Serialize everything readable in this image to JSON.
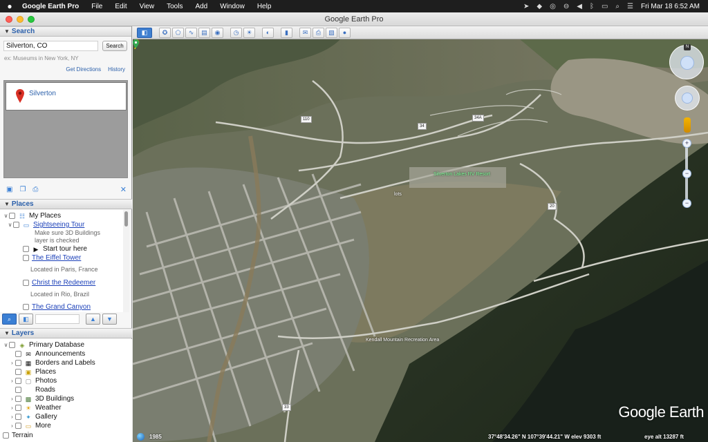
{
  "menubar": {
    "app_name": "Google Earth Pro",
    "menus": [
      "File",
      "Edit",
      "View",
      "Tools",
      "Add",
      "Window",
      "Help"
    ],
    "clock": "Fri Mar 18  6:52 AM"
  },
  "window": {
    "title": "Google Earth Pro"
  },
  "search": {
    "header": "Search",
    "query": "Silverton, CO",
    "button_label": "Search",
    "hint": "ex: Museums in New York, NY",
    "get_directions": "Get Directions",
    "history": "History",
    "result_label": "Silverton"
  },
  "places": {
    "header": "Places",
    "my_places": "My Places",
    "sightseeing_tour": "Sightseeing Tour",
    "tour_note_1": "Make sure 3D Buildings",
    "tour_note_2": "layer is checked",
    "start_tour": "Start tour here",
    "eiffel": "The Eiffel Tower",
    "eiffel_loc": "Located in Paris, France",
    "christ": "Christ the Redeemer",
    "christ_loc": "Located in Rio, Brazil",
    "canyon": "The Grand Canyon"
  },
  "layers": {
    "header": "Layers",
    "items": [
      "Primary Database",
      "Announcements",
      "Borders and Labels",
      "Places",
      "Photos",
      "Roads",
      "3D Buildings",
      "Weather",
      "Gallery",
      "More",
      "Terrain"
    ]
  },
  "map": {
    "labels": {
      "resort": "Silverton Lakes RV Resort",
      "lots": "lots",
      "kendall": "Kendall Mountain Recreation Area"
    },
    "road_shields": [
      "110",
      "34",
      "34A",
      "20",
      "33"
    ],
    "watermark": "Google Earth",
    "imagery_year": "1985",
    "coords": "37°48'34.26\" N   107°39'44.21\" W   elev  9303 ft",
    "eye_alt": "eye alt  13287 ft",
    "compass_north": "N"
  }
}
